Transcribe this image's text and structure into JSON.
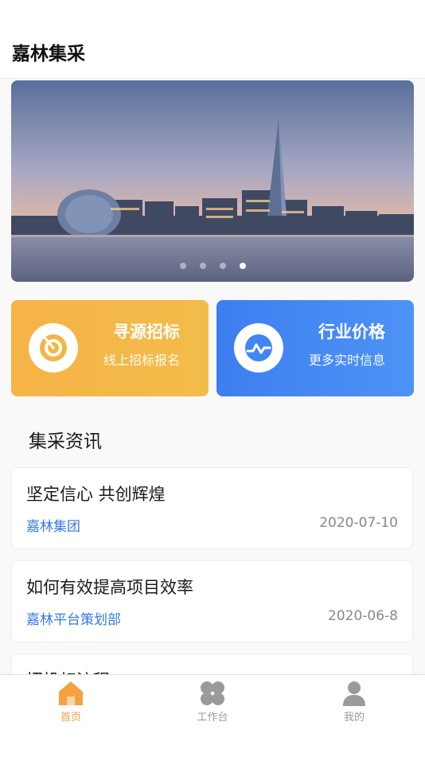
{
  "app": {
    "title": "嘉林集采"
  },
  "banner": {
    "slide_count": 4,
    "active_slide": 4
  },
  "quick_entries": [
    {
      "title": "寻源招标",
      "subtitle": "线上招标报名",
      "icon": "target-icon",
      "color": "#f5b545"
    },
    {
      "title": "行业价格",
      "subtitle": "更多实时信息",
      "icon": "price-wave-icon",
      "color": "#4087f2"
    }
  ],
  "news": {
    "section_title": "集采资讯",
    "items": [
      {
        "title": "坚定信心 共创辉煌",
        "source": "嘉林集团",
        "date": "2020-07-10"
      },
      {
        "title": "如何有效提高项目效率",
        "source": "嘉林平台策划部",
        "date": "2020-06-8"
      },
      {
        "title": "招投标流程",
        "source": "",
        "date": ""
      }
    ]
  },
  "tabbar": {
    "active_color": "#f5a142",
    "inactive_color": "#9a9a9a",
    "items": [
      {
        "label": "首页",
        "icon": "home-icon",
        "active": true
      },
      {
        "label": "工作台",
        "icon": "workbench-icon",
        "active": false
      },
      {
        "label": "我的",
        "icon": "profile-icon",
        "active": false
      }
    ]
  }
}
